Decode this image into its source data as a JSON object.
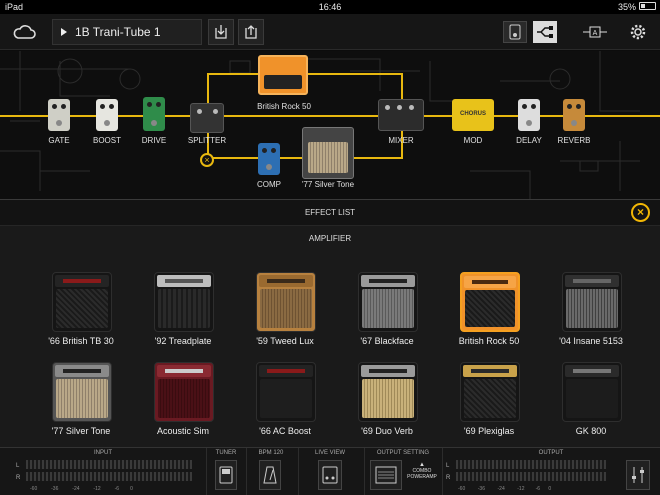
{
  "status": {
    "carrier": "iPad",
    "time": "16:46",
    "battery": "35%"
  },
  "topbar": {
    "preset_name": "1B Trani-Tube 1"
  },
  "chain": {
    "labels": {
      "gate": "GATE",
      "boost": "BOOST",
      "drive": "DRIVE",
      "splitter": "SPLITTER",
      "amp_a": "British Rock 50",
      "comp": "COMP",
      "amp_b": "'77 Silver Tone",
      "mixer": "MIXER",
      "mod": "MOD",
      "delay": "DELAY",
      "reverb": "REVERB"
    },
    "pedals": {
      "mod_text": "CHORUS"
    }
  },
  "panel": {
    "title": "EFFECT LIST",
    "category": "AMPLIFIER",
    "amps": [
      {
        "name": "'66 British TB 30"
      },
      {
        "name": "'92 Treadplate"
      },
      {
        "name": "'59 Tweed Lux"
      },
      {
        "name": "'67 Blackface"
      },
      {
        "name": "British Rock 50"
      },
      {
        "name": "'04 Insane 5153"
      },
      {
        "name": "'77 Silver Tone"
      },
      {
        "name": "Acoustic Sim"
      },
      {
        "name": "'66 AC Boost"
      },
      {
        "name": "'69 Duo Verb"
      },
      {
        "name": "'69 Plexiglas"
      },
      {
        "name": "GK 800"
      }
    ]
  },
  "bottombar": {
    "input_label": "INPUT",
    "tuner_label": "TUNER",
    "bpm_label": "BPM 120",
    "liveview_label": "LIVE VIEW",
    "output_setting_label": "OUTPUT SETTING",
    "output_label": "OUTPUT",
    "combo_label": "COMBO POWERAMP",
    "channel_l": "L",
    "channel_r": "R",
    "scale": [
      "-60",
      "-36",
      "-24",
      "-12",
      "-6",
      "0"
    ]
  },
  "colors": {
    "accent": "#f2b705",
    "wire": "#e8b80f",
    "selected": "#f5a020"
  }
}
